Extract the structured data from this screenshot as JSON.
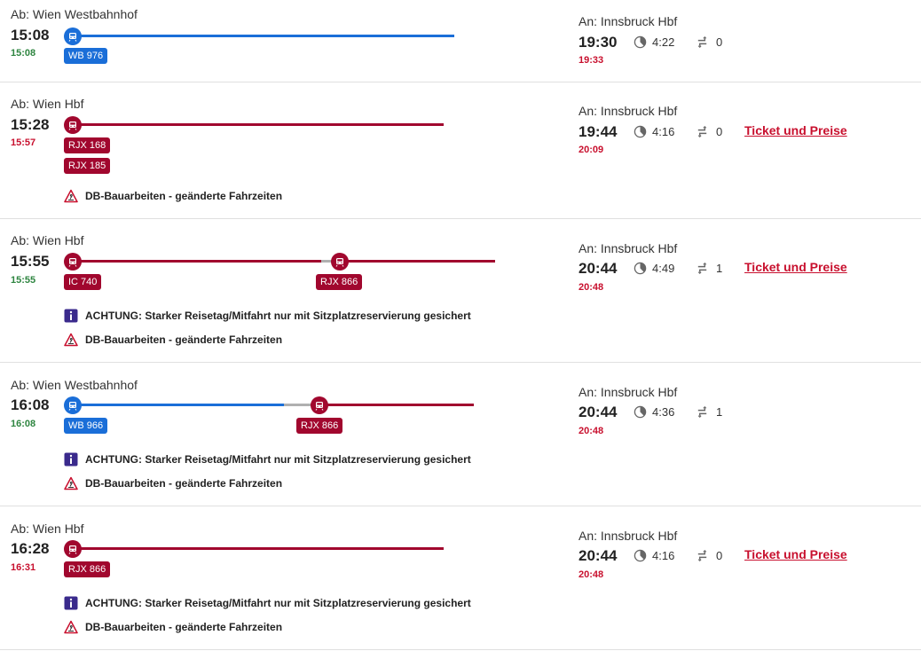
{
  "colors": {
    "westbahn": "#1a6ed8",
    "oebb": "#a1072e",
    "ontime": "#2e8540",
    "late": "#c8102e"
  },
  "connections": [
    {
      "dep_station": "Ab: Wien Westbahnhof",
      "dep_time": "15:08",
      "dep_realtime": "15:08",
      "arr_station": "An: Innsbruck Hbf",
      "arr_time": "19:30",
      "arr_realtime": "19:33",
      "duration": "4:22",
      "changes": "0",
      "ticket": "",
      "trains": [
        "WB 976"
      ],
      "notices": []
    },
    {
      "dep_station": "Ab: Wien Hbf",
      "dep_time": "15:28",
      "dep_realtime": "15:57",
      "arr_station": "An: Innsbruck Hbf",
      "arr_time": "19:44",
      "arr_realtime": "20:09",
      "duration": "4:16",
      "changes": "0",
      "ticket": "Ticket und Preise",
      "trains": [
        "RJX 168",
        "RJX 185"
      ],
      "notices": [
        "DB-Bauarbeiten - geänderte Fahrzeiten"
      ]
    },
    {
      "dep_station": "Ab: Wien Hbf",
      "dep_time": "15:55",
      "dep_realtime": "15:55",
      "arr_station": "An: Innsbruck Hbf",
      "arr_time": "20:44",
      "arr_realtime": "20:48",
      "duration": "4:49",
      "changes": "1",
      "ticket": "Ticket und Preise",
      "trains": [
        "IC 740",
        "RJX 866"
      ],
      "notices": [
        "ACHTUNG: Starker Reisetag/Mitfahrt nur mit Sitzplatzreservierung gesichert",
        "DB-Bauarbeiten - geänderte Fahrzeiten"
      ]
    },
    {
      "dep_station": "Ab: Wien Westbahnhof",
      "dep_time": "16:08",
      "dep_realtime": "16:08",
      "arr_station": "An: Innsbruck Hbf",
      "arr_time": "20:44",
      "arr_realtime": "20:48",
      "duration": "4:36",
      "changes": "1",
      "ticket": "",
      "trains": [
        "WB 966",
        "RJX 866"
      ],
      "notices": [
        "ACHTUNG: Starker Reisetag/Mitfahrt nur mit Sitzplatzreservierung gesichert",
        "DB-Bauarbeiten - geänderte Fahrzeiten"
      ]
    },
    {
      "dep_station": "Ab: Wien Hbf",
      "dep_time": "16:28",
      "dep_realtime": "16:31",
      "arr_station": "An: Innsbruck Hbf",
      "arr_time": "20:44",
      "arr_realtime": "20:48",
      "duration": "4:16",
      "changes": "0",
      "ticket": "Ticket und Preise",
      "trains": [
        "RJX 866"
      ],
      "notices": [
        "ACHTUNG: Starker Reisetag/Mitfahrt nur mit Sitzplatzreservierung gesichert",
        "DB-Bauarbeiten - geänderte Fahrzeiten"
      ]
    }
  ]
}
